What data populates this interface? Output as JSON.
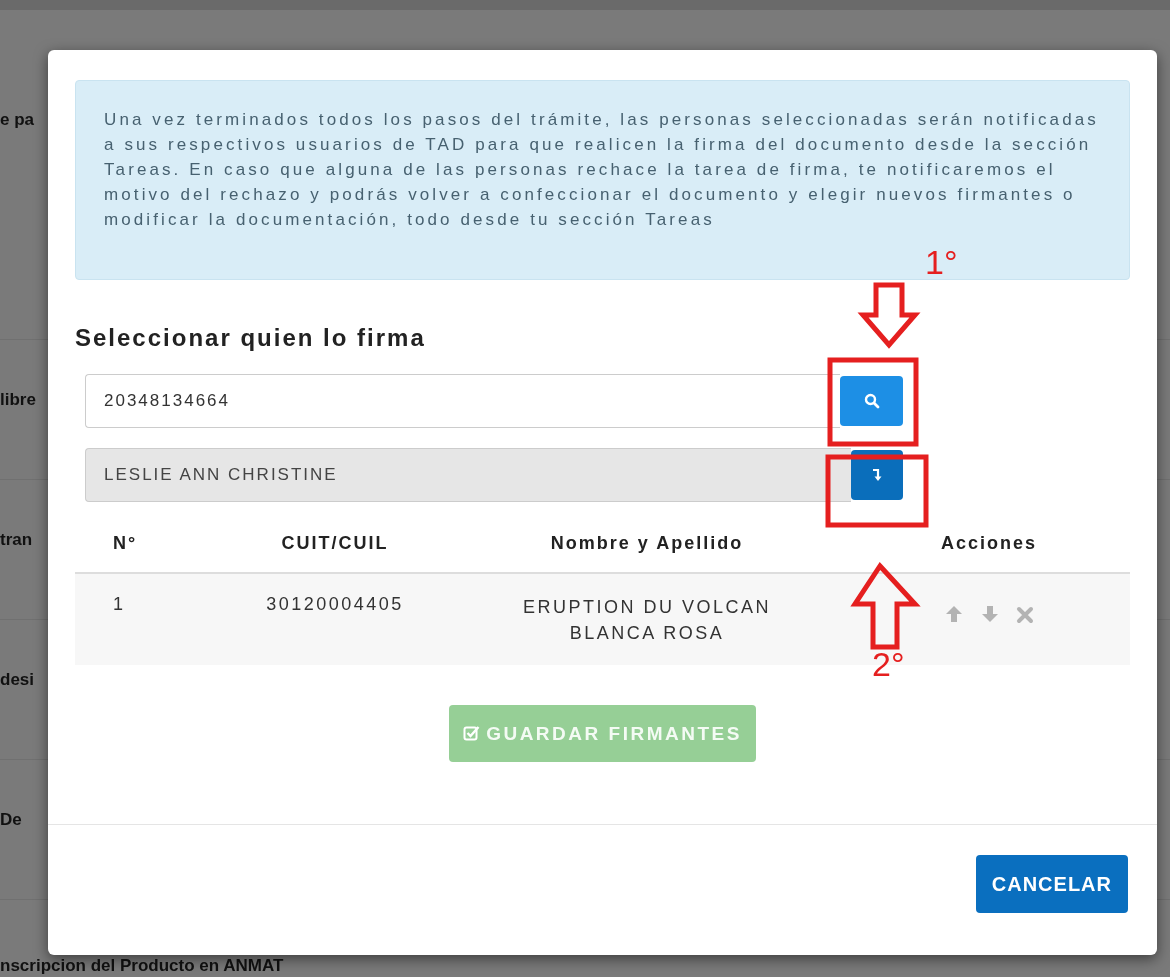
{
  "background_page": {
    "labels": [
      "e pa",
      "libre",
      "tran",
      "desi",
      "De",
      "nscripcion del Producto en ANMAT"
    ]
  },
  "modal": {
    "notice": "Una vez terminados todos los pasos del trámite, las personas seleccionadas serán notificadas a sus respectivos usuarios de TAD para que realicen la firma del documento desde la sección Tareas. En caso que alguna de las personas rechace la tarea de firma, te notificaremos el motivo del rechazo y podrás volver a confeccionar el documento y elegir nuevos firmantes o modificar la documentación, todo desde tu sección Tareas",
    "heading": "Seleccionar quien lo firma",
    "search": {
      "value": "20348134664"
    },
    "selected_person": {
      "value": "LESLIE ANN CHRISTINE"
    },
    "table": {
      "columns": [
        "N°",
        "CUIT/CUIL",
        "Nombre y Apellido",
        "Acciones"
      ],
      "rows": [
        {
          "number": "1",
          "cuit": "30120004405",
          "name": "ERUPTION DU VOLCAN BLANCA ROSA"
        }
      ]
    },
    "save_button": {
      "label": "GUARDAR FIRMANTES",
      "disabled": true
    },
    "cancel_button": {
      "label": "CANCELAR"
    }
  },
  "annotations": [
    {
      "kind": "step",
      "text": "1°"
    },
    {
      "kind": "step",
      "text": "2°"
    }
  ]
}
